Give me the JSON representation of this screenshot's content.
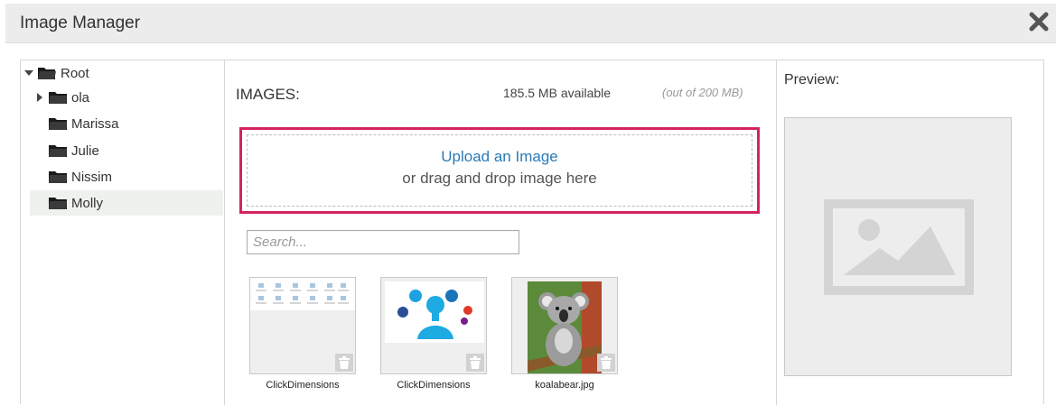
{
  "dialog": {
    "title": "Image Manager",
    "close_icon": "close-x-icon"
  },
  "tree": {
    "root": {
      "label": "Root",
      "expanded": true
    },
    "items": [
      {
        "label": "ola",
        "has_children": true,
        "selected": false
      },
      {
        "label": "Marissa",
        "has_children": false,
        "selected": false
      },
      {
        "label": "Julie",
        "has_children": false,
        "selected": false
      },
      {
        "label": "Nissim",
        "has_children": false,
        "selected": false
      },
      {
        "label": "Molly",
        "has_children": false,
        "selected": true
      }
    ]
  },
  "images": {
    "label": "IMAGES:",
    "available": "185.5 MB available",
    "out_of": "(out of 200 MB)"
  },
  "upload": {
    "link_text": "Upload an Image",
    "drag_text": "or drag and drop image here"
  },
  "search": {
    "placeholder": "Search...",
    "value": ""
  },
  "thumbnails": [
    {
      "caption": "ClickDimensions"
    },
    {
      "caption": "ClickDimensions"
    },
    {
      "caption": "koalabear.jpg"
    }
  ],
  "preview": {
    "label": "Preview:"
  },
  "colors": {
    "accent_border": "#d4245c",
    "link": "#2a7ab5",
    "titlebar": "#ececec"
  }
}
